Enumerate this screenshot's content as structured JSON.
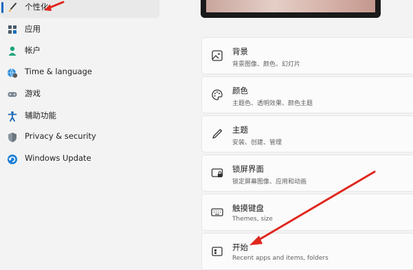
{
  "sidebar": {
    "items": [
      {
        "label": "个性化",
        "icon": "brush-icon"
      },
      {
        "label": "应用",
        "icon": "apps-icon"
      },
      {
        "label": "帐户",
        "icon": "person-icon"
      },
      {
        "label": "Time & language",
        "icon": "globe-clock-icon"
      },
      {
        "label": "游戏",
        "icon": "gamepad-icon"
      },
      {
        "label": "辅助功能",
        "icon": "accessibility-icon"
      },
      {
        "label": "Privacy & security",
        "icon": "shield-icon"
      },
      {
        "label": "Windows Update",
        "icon": "update-icon"
      }
    ],
    "selected": "个性化"
  },
  "main": {
    "cards": [
      {
        "title": "背景",
        "subtitle": "背景图像、颜色、幻灯片",
        "icon": "image-icon"
      },
      {
        "title": "颜色",
        "subtitle": "主题色、透明效果、颜色主题",
        "icon": "palette-icon"
      },
      {
        "title": "主题",
        "subtitle": "安装、创建、管理",
        "icon": "pen-icon"
      },
      {
        "title": "锁屏界面",
        "subtitle": "锁定屏幕图像、应用和动画",
        "icon": "lock-screen-icon"
      },
      {
        "title": "触摸键盘",
        "subtitle": "Themes, size",
        "icon": "keyboard-icon"
      },
      {
        "title": "开始",
        "subtitle": "Recent apps and items, folders",
        "icon": "start-icon"
      }
    ]
  },
  "colors": {
    "accent": "#0067c0",
    "annotation_arrow": "#e0271e"
  }
}
